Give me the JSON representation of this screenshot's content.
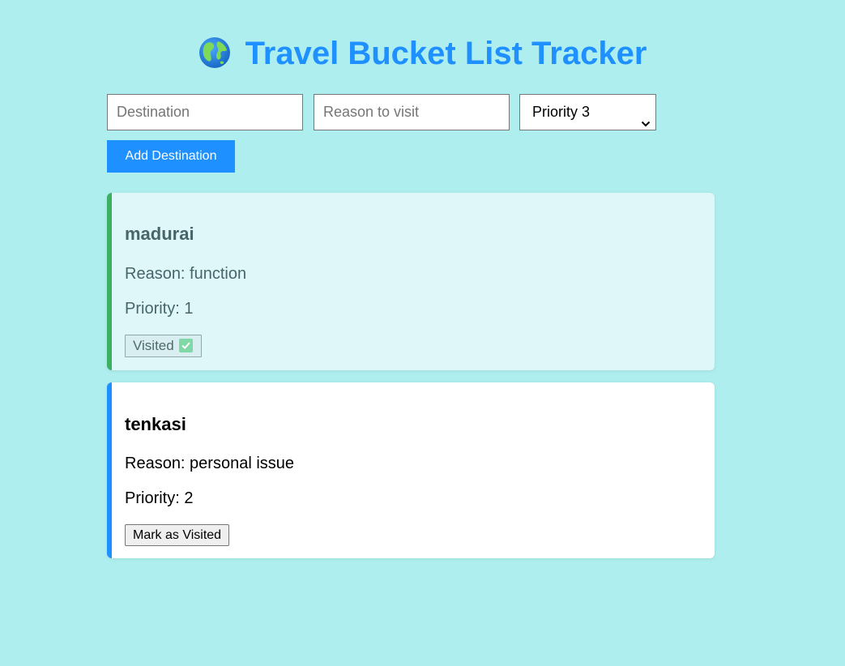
{
  "app": {
    "title": "Travel Bucket List Tracker",
    "title_icon": "globe-icon",
    "accent_color": "#1e90ff",
    "background_color": "#afeeee"
  },
  "form": {
    "destination_placeholder": "Destination",
    "destination_value": "",
    "reason_placeholder": "Reason to visit",
    "reason_value": "",
    "priority_selected": "Priority 3",
    "add_button_label": "Add Destination"
  },
  "destinations": [
    {
      "name": "madurai",
      "reason_text": "Reason: function",
      "priority_text": "Priority: 1",
      "visited": true,
      "status_label": "Visited",
      "status_icon": "check-box-icon",
      "border_color": "#3cb062"
    },
    {
      "name": "tenkasi",
      "reason_text": "Reason: personal issue",
      "priority_text": "Priority: 2",
      "visited": false,
      "action_label": "Mark as Visited",
      "border_color": "#1e90ff"
    }
  ]
}
